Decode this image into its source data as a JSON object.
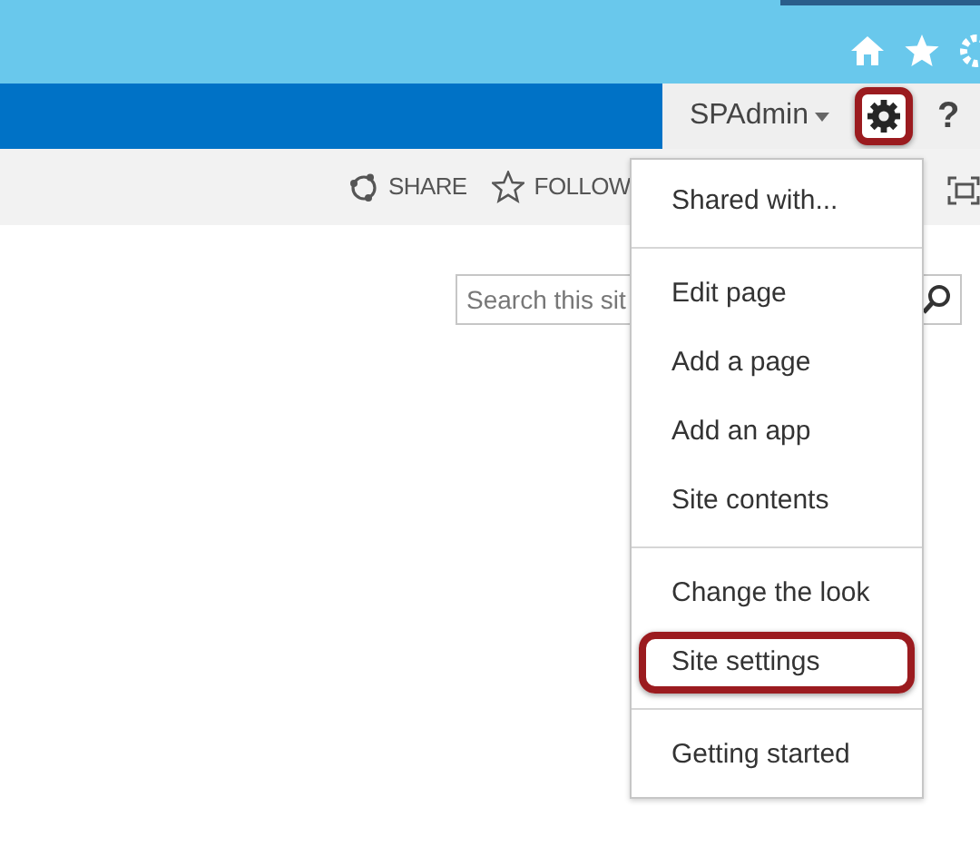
{
  "suite_bar": {
    "user": "SPAdmin",
    "settings_highlighted": true,
    "help": "?"
  },
  "actions": [
    {
      "label": "SHARE",
      "kind": "share"
    },
    {
      "label": "FOLLOW",
      "kind": "follow"
    }
  ],
  "search": {
    "placeholder": "Search this sit"
  },
  "settings_menu": [
    [
      {
        "label": "Shared with...",
        "highlighted": false
      }
    ],
    [
      {
        "label": "Edit page",
        "highlighted": false
      },
      {
        "label": "Add a page",
        "highlighted": false
      },
      {
        "label": "Add an app",
        "highlighted": false
      },
      {
        "label": "Site contents",
        "highlighted": false
      }
    ],
    [
      {
        "label": "Change the look",
        "highlighted": false
      },
      {
        "label": "Site settings",
        "highlighted": true
      }
    ],
    [
      {
        "label": "Getting started",
        "highlighted": false
      }
    ]
  ]
}
